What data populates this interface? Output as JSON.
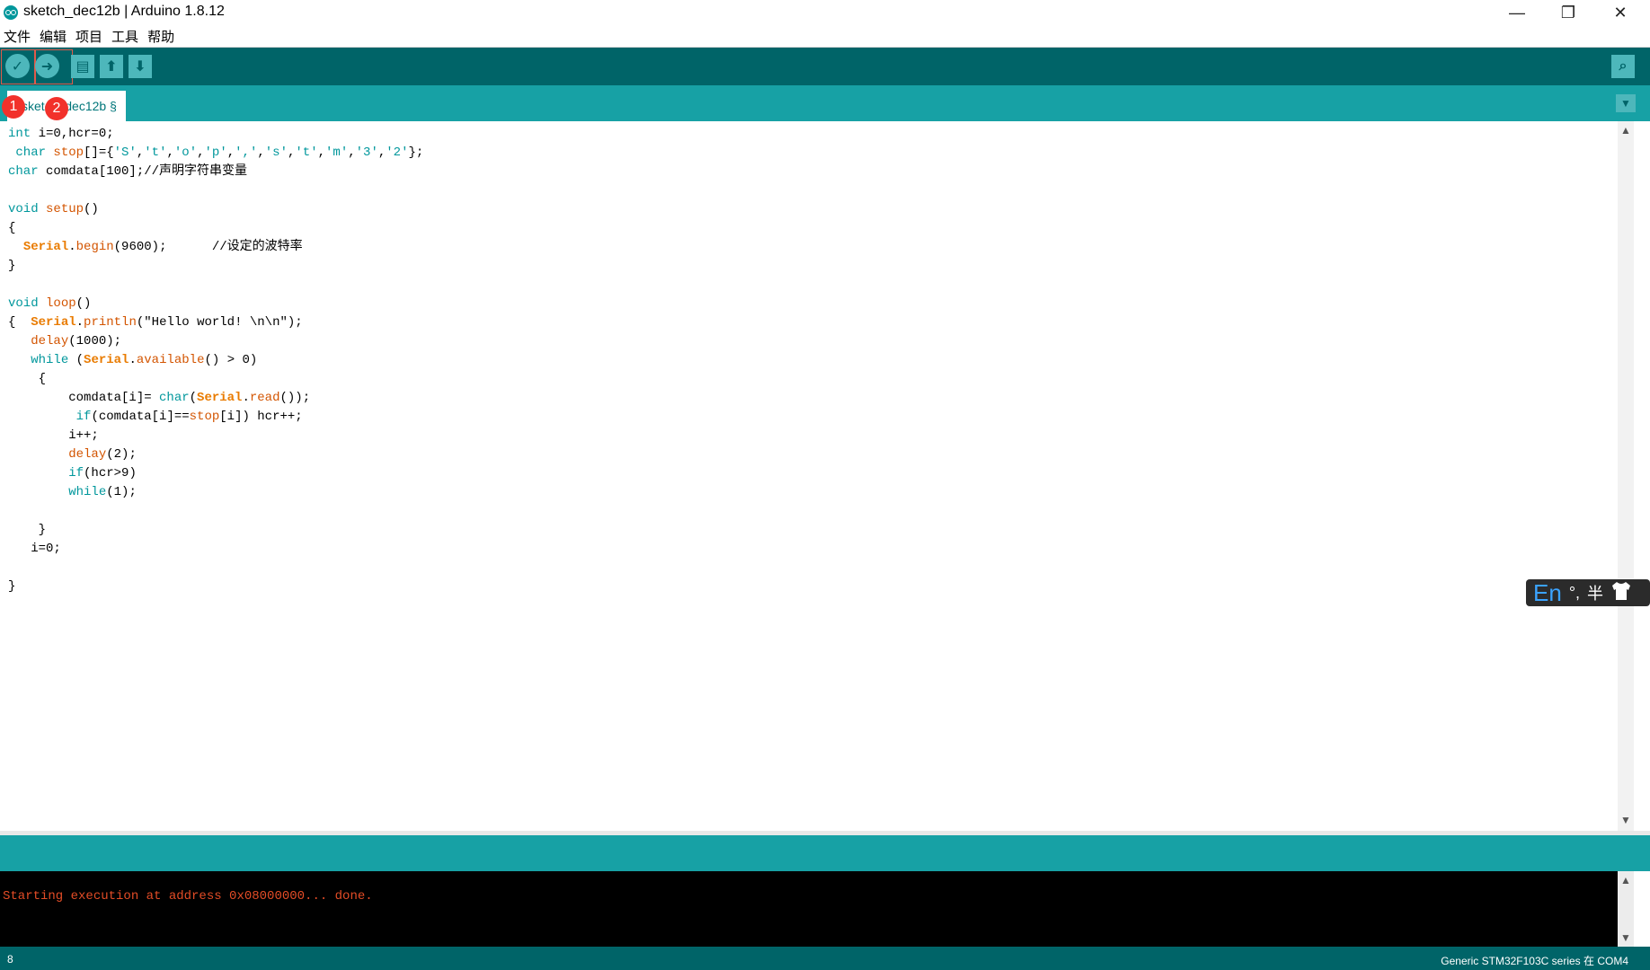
{
  "window": {
    "title": "sketch_dec12b | Arduino 1.8.12",
    "minimize": "—",
    "restore": "❐",
    "close": "✕"
  },
  "menu": [
    "文件",
    "编辑",
    "项目",
    "工具",
    "帮助"
  ],
  "toolbar": {
    "verify_icon": "✓",
    "upload_icon": "➜",
    "new_icon": "▤",
    "open_icon": "⬆",
    "save_icon": "⬇",
    "serial_monitor_icon": "⌕"
  },
  "tab": {
    "label": "sketch_dec12b §",
    "menu_icon": "▼"
  },
  "annotations": {
    "badge_1": "1",
    "badge_2": "2"
  },
  "code_lines": [
    "int i=0,hcr=0;",
    " char stop[]={'S','t','o','p',',','s','t','m','3','2'};",
    "char comdata[100];//声明字符串变量",
    "",
    "void setup()",
    "{",
    "  Serial.begin(9600);      //设定的波特率",
    "}",
    "",
    "void loop()",
    "{  Serial.println(\"Hello world! \\n\\n\");",
    "   delay(1000);",
    "   while (Serial.available() > 0)",
    "    {",
    "        comdata[i]= char(Serial.read());",
    "         if(comdata[i]==stop[i]) hcr++;",
    "        i++;",
    "        delay(2);",
    "        if(hcr>9)",
    "        while(1);",
    "",
    "    }",
    "   i=0;",
    "",
    "}"
  ],
  "ime": {
    "mode": "En",
    "punct": "°,",
    "width": "半",
    "skin_icon": "shirt-icon"
  },
  "console": {
    "message": "Starting execution at address 0x08000000... done."
  },
  "status": {
    "line_number": "8",
    "board": "Generic STM32F103C series 在 COM4"
  },
  "colors": {
    "toolbar": "#006468",
    "tabbar": "#17a1a5",
    "keyword": "#00979c",
    "function": "#d35400",
    "class": "#e97b00",
    "console_text": "#e34c26"
  }
}
